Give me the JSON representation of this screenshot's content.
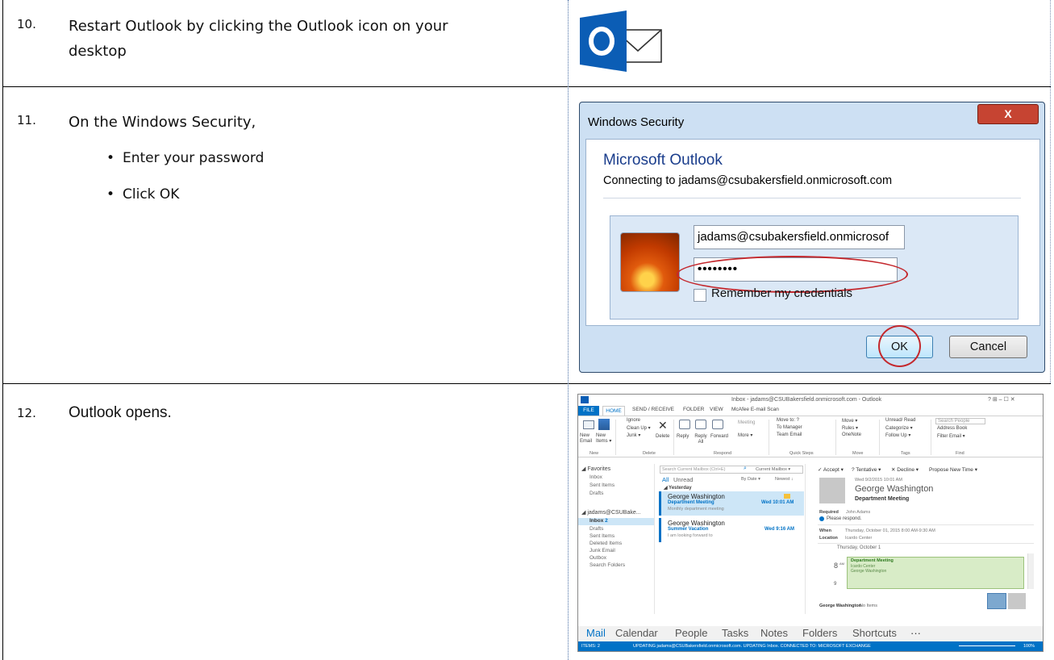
{
  "steps": [
    {
      "number": "10.",
      "text_line1": "Restart Outlook by clicking the Outlook icon on your",
      "text_line2": "desktop"
    },
    {
      "number": "11.",
      "text": "On the Windows Security,",
      "bullets": [
        "Enter your password",
        "Click OK"
      ]
    },
    {
      "number": "12.",
      "text": "Outlook opens."
    }
  ],
  "outlook_icon": {
    "letter": "O",
    "name": "outlook-icon",
    "color": "#0b5db5"
  },
  "dialog": {
    "title": "Windows Security",
    "close": "X",
    "heading": "Microsoft Outlook",
    "subheading": "Connecting to jadams@csubakersfield.onmicrosoft.com",
    "username": "jadams@csubakersfield.onmicrosof",
    "password_mask": "••••••••",
    "remember": "Remember my credentials",
    "ok": "OK",
    "cancel": "Cancel"
  },
  "outlook": {
    "window_title": "Inbox - jadams@CSUBakersfield.onmicrosoft.com - Outlook",
    "window_controls": "?  ⊞  –  ☐  ✕",
    "tabs": [
      "FILE",
      "HOME",
      "SEND / RECEIVE",
      "FOLDER",
      "VIEW",
      "McAfee E-mail Scan"
    ],
    "ribbon": {
      "new_email": "New Email",
      "new_items": "New Items ▾",
      "ignore": "Ignore",
      "clean_up": "Clean Up ▾",
      "junk": "Junk ▾",
      "delete": "Delete",
      "reply": "Reply",
      "reply_all": "Reply All",
      "forward": "Forward",
      "meeting": "Meeting",
      "more": "More ▾",
      "move_to": "Move to: ?",
      "to_manager": "To Manager",
      "team_email": "Team Email",
      "move": "Move ▾",
      "rules": "Rules ▾",
      "onenote": "OneNote",
      "unread_read": "Unread/ Read",
      "categorize": "Categorize ▾",
      "follow_up": "Follow Up ▾",
      "search_people": "Search People",
      "address_book": "Address Book",
      "filter_email": "Filter Email ▾",
      "groups": [
        "New",
        "Delete",
        "Respond",
        "Quick Steps",
        "Move",
        "Tags",
        "Find"
      ]
    },
    "nav": {
      "favorites": "◢ Favorites",
      "fav_items": [
        "Inbox",
        "Sent Items",
        "Drafts"
      ],
      "account": "◢ jadams@CSUBake...",
      "inbox_label": "Inbox",
      "inbox_count": "2",
      "account_items": [
        "Drafts",
        "Sent Items",
        "Deleted Items",
        "Junk Email",
        "Outbox",
        "Search Folders"
      ]
    },
    "list": {
      "search_placeholder": "Search Current Mailbox (Ctrl+E)",
      "scope": "Current Mailbox ▾",
      "filter_all": "All",
      "filter_unread": "Unread",
      "sort_by": "By Date ▾",
      "sort_order": "Newest ↓",
      "group": "◢ Yesterday",
      "messages": [
        {
          "from": "George Washington",
          "subject": "Department Meeting",
          "time": "Wed 10:01 AM",
          "preview": "Monthly department meeting"
        },
        {
          "from": "George Washington",
          "subject": "Summer Vacation",
          "time": "Wed 9:16 AM",
          "preview": "I am looking forward to"
        }
      ]
    },
    "reading": {
      "accept": "✓ Accept ▾",
      "tentative": "? Tentative ▾",
      "decline": "✕ Decline ▾",
      "propose": "Propose New Time ▾",
      "sent": "Wed 9/2/2015 10:01 AM",
      "sender": "George Washington",
      "subject": "Department Meeting",
      "required_label": "Required",
      "required": "John Adams",
      "respond": "Please respond.",
      "when_label": "When",
      "when": "Thursday, October 01, 2015 8:00 AM-9:30 AM",
      "location_label": "Location",
      "location": "Icardo Center",
      "calendar_day": "Thursday, October 1",
      "hour": "8",
      "hour_suffix": "AM",
      "hour_next": "9",
      "event_title": "Department Meeting",
      "event_loc": "Icardo Center",
      "event_org": "George Washington",
      "footer": "George Washington",
      "footer_items": "No Items"
    },
    "bottom_nav": [
      "Mail",
      "Calendar",
      "People",
      "Tasks",
      "Notes",
      "Folders",
      "Shortcuts",
      "···"
    ],
    "status": {
      "items": "ITEMS: 2",
      "updating": "UPDATING jadams@CSUBakersfield.onmicrosoft.com.  UPDATING Inbox.   CONNECTED TO: MICROSOFT EXCHANGE",
      "zoom": "100%"
    }
  }
}
